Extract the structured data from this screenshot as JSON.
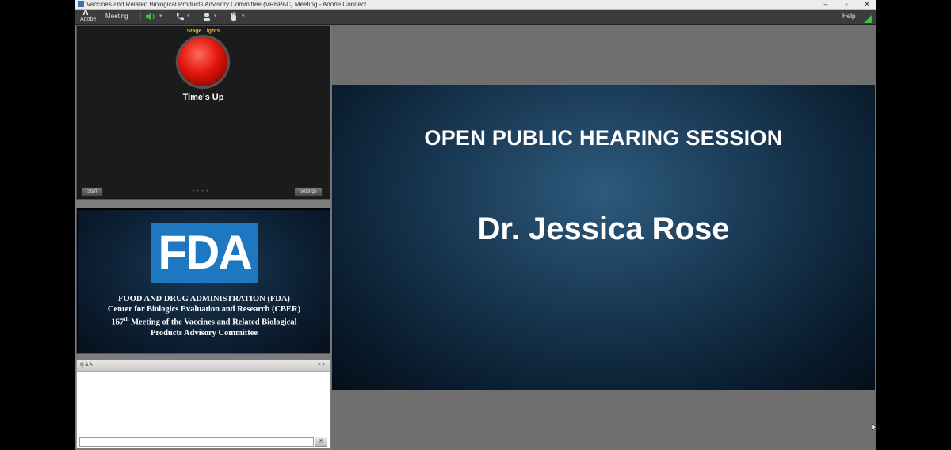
{
  "window": {
    "title": "Vaccines and Related Biological Products Advisory Committee (VRBPAC) Meeting - Adobe Connect",
    "minimize": "–",
    "restore": "▫",
    "close": "✕"
  },
  "menubar": {
    "logo_letter": "A",
    "logo_text": "Adobe",
    "meeting_label": "Meeting",
    "icons": [
      "speaker-icon",
      "phone-icon",
      "webcam-person-icon",
      "raise-hand-icon"
    ],
    "help_label": "Help",
    "status_color": "#3cc43c"
  },
  "stage_lights": {
    "title": "Stage Lights",
    "light_color": "#e3150c",
    "message": "Time's Up",
    "start_label": "Start",
    "settings_label": "Settings",
    "dots": "• • • •"
  },
  "share_pod": {
    "logo_text": "FDA",
    "line1": "FOOD AND DRUG ADMINISTRATION (FDA)",
    "line2": "Center for Biologics Evaluation and Research (CBER)",
    "line3_num": "167",
    "line3_sup": "th",
    "line3_rest": " Meeting of the Vaccines and Related Biological",
    "line4": "Products Advisory Committee"
  },
  "qa_pod": {
    "title": "Q & A",
    "menu_glyph": "≡ ▾",
    "send_glyph": "✉"
  },
  "main_slide": {
    "heading": "OPEN PUBLIC HEARING SESSION",
    "speaker": "Dr. Jessica Rose"
  }
}
